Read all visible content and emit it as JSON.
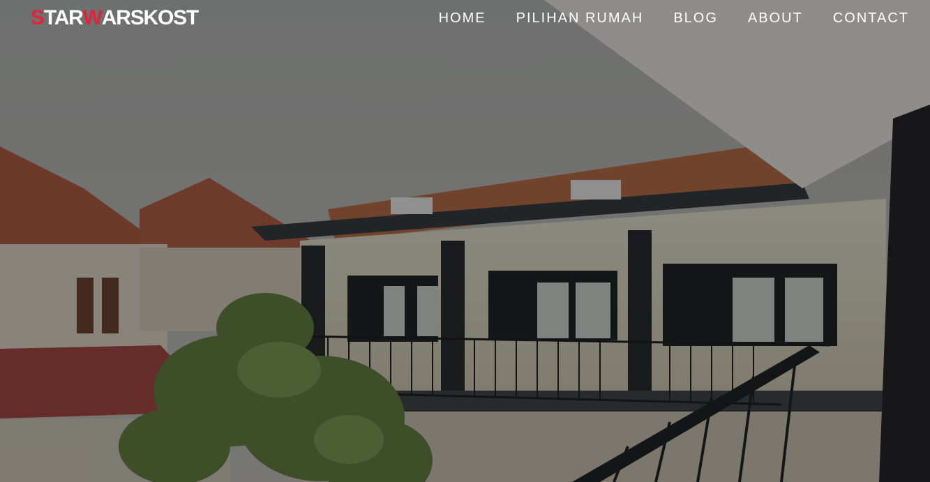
{
  "brand": {
    "parts": [
      {
        "text": "S",
        "accent": true
      },
      {
        "text": "TAR",
        "accent": false
      },
      {
        "text": "W",
        "accent": true
      },
      {
        "text": "ARSKOST",
        "accent": false
      }
    ],
    "accent_color": "#e2223b"
  },
  "nav": {
    "items": [
      {
        "label": "HOME"
      },
      {
        "label": "PILIHAN RUMAH"
      },
      {
        "label": "BLOG"
      },
      {
        "label": "ABOUT"
      },
      {
        "label": "CONTACT"
      }
    ]
  },
  "hero": {
    "image_semantic": "kost-building-balcony-photo"
  }
}
